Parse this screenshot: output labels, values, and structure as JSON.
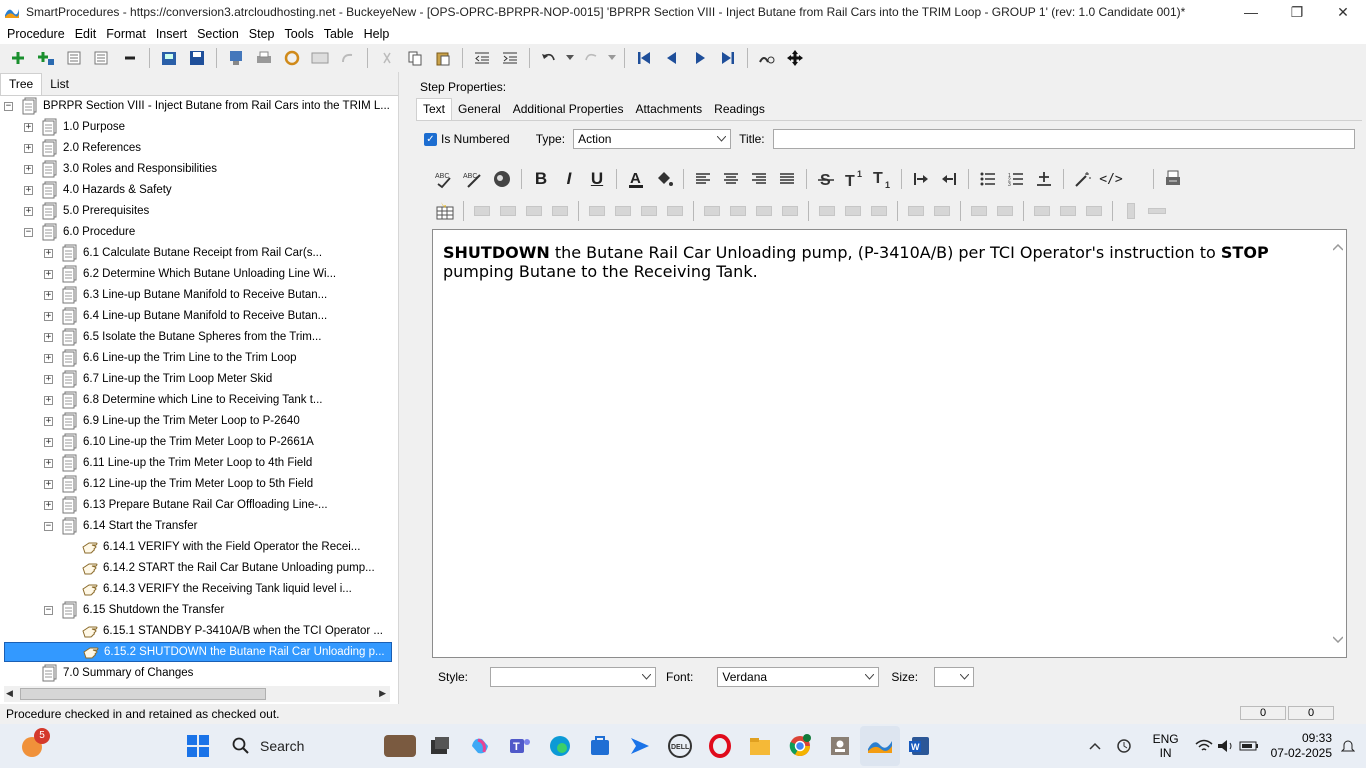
{
  "window": {
    "title": "SmartProcedures - https://conversion3.atrcloudhosting.net - BuckeyeNew - [OPS-OPRC-BPRPR-NOP-0015] 'BPRPR Section VIII - Inject Butane from Rail Cars into the TRIM Loop - GROUP 1' (rev: 1.0 Candidate 001)*"
  },
  "menu": [
    "Procedure",
    "Edit",
    "Format",
    "Insert",
    "Section",
    "Step",
    "Tools",
    "Table",
    "Help"
  ],
  "left_tabs": {
    "tree": "Tree",
    "list": "List"
  },
  "tree": {
    "root": "BPRPR Section VIII - Inject Butane from Rail Cars into the TRIM L...",
    "nodes": [
      {
        "label": "1.0 Purpose",
        "indent": 1,
        "expander": "+",
        "icon": "doc"
      },
      {
        "label": "2.0 References",
        "indent": 1,
        "expander": "+",
        "icon": "doc"
      },
      {
        "label": "3.0 Roles and Responsibilities",
        "indent": 1,
        "expander": "+",
        "icon": "doc"
      },
      {
        "label": "4.0 Hazards & Safety",
        "indent": 1,
        "expander": "+",
        "icon": "doc"
      },
      {
        "label": "5.0 Prerequisites",
        "indent": 1,
        "expander": "+",
        "icon": "doc"
      },
      {
        "label": "6.0 Procedure",
        "indent": 1,
        "expander": "-",
        "icon": "doc"
      },
      {
        "label": "6.1 Calculate Butane Receipt from Rail Car(s...",
        "indent": 2,
        "expander": "+",
        "icon": "doc"
      },
      {
        "label": "6.2 Determine Which Butane Unloading Line Wi...",
        "indent": 2,
        "expander": "+",
        "icon": "doc"
      },
      {
        "label": "6.3 Line-up Butane Manifold to Receive Butan...",
        "indent": 2,
        "expander": "+",
        "icon": "doc"
      },
      {
        "label": "6.4 Line-up Butane Manifold to Receive Butan...",
        "indent": 2,
        "expander": "+",
        "icon": "doc"
      },
      {
        "label": "6.5 Isolate the Butane Spheres from the Trim...",
        "indent": 2,
        "expander": "+",
        "icon": "doc"
      },
      {
        "label": "6.6 Line-up the Trim Line to the Trim Loop",
        "indent": 2,
        "expander": "+",
        "icon": "doc"
      },
      {
        "label": "6.7 Line-up the Trim Loop Meter Skid",
        "indent": 2,
        "expander": "+",
        "icon": "doc"
      },
      {
        "label": "6.8 Determine which Line to Receiving Tank t...",
        "indent": 2,
        "expander": "+",
        "icon": "doc"
      },
      {
        "label": "6.9 Line-up the Trim Meter Loop to P-2640",
        "indent": 2,
        "expander": "+",
        "icon": "doc"
      },
      {
        "label": "6.10 Line-up the Trim Meter Loop to P-2661A",
        "indent": 2,
        "expander": "+",
        "icon": "doc"
      },
      {
        "label": "6.11 Line-up the Trim Meter Loop to 4th Field",
        "indent": 2,
        "expander": "+",
        "icon": "doc"
      },
      {
        "label": "6.12 Line-up the Trim Meter Loop to 5th Field",
        "indent": 2,
        "expander": "+",
        "icon": "doc"
      },
      {
        "label": "6.13 Prepare Butane Rail Car Offloading Line-...",
        "indent": 2,
        "expander": "+",
        "icon": "doc"
      },
      {
        "label": "6.14 Start the Transfer",
        "indent": 2,
        "expander": "-",
        "icon": "doc"
      },
      {
        "label": "6.14.1 VERIFY with the Field Operator the Recei...",
        "indent": 3,
        "expander": "",
        "icon": "hand"
      },
      {
        "label": "6.14.2 START the Rail Car Butane Unloading pump...",
        "indent": 3,
        "expander": "",
        "icon": "hand"
      },
      {
        "label": "6.14.3 VERIFY the Receiving Tank liquid level i...",
        "indent": 3,
        "expander": "",
        "icon": "hand"
      },
      {
        "label": "6.15 Shutdown the Transfer",
        "indent": 2,
        "expander": "-",
        "icon": "doc"
      },
      {
        "label": "6.15.1 STANDBY P-3410A/B when the TCI Operator ...",
        "indent": 3,
        "expander": "",
        "icon": "hand"
      },
      {
        "label": "6.15.2 SHUTDOWN the Butane Rail Car Unloading p...",
        "indent": 3,
        "expander": "",
        "icon": "hand",
        "selected": true
      },
      {
        "label": "7.0 Summary of Changes",
        "indent": 1,
        "expander": "",
        "icon": "doc"
      }
    ]
  },
  "step_properties": {
    "label": "Step Properties:",
    "tabs": [
      "Text",
      "General",
      "Additional Properties",
      "Attachments",
      "Readings"
    ],
    "is_numbered_label": "Is Numbered",
    "type_label": "Type:",
    "type_value": "Action",
    "title_label": "Title:",
    "title_value": ""
  },
  "editor": {
    "segments": [
      {
        "text": "SHUTDOWN",
        "bold": true
      },
      {
        "text": " the Butane Rail Car Unloading pump, (P-3410A/B) per TCI Operator's instruction to ",
        "bold": false
      },
      {
        "text": "STOP",
        "bold": true
      },
      {
        "text": " pumping Butane to the Receiving Tank.",
        "bold": false
      }
    ]
  },
  "format_bar": {
    "style_label": "Style:",
    "style_value": "",
    "font_label": "Font:",
    "font_value": "Verdana",
    "size_label": "Size:",
    "size_value": ""
  },
  "status": {
    "text": "Procedure checked in and retained as checked out.",
    "right1": "0",
    "right2": "0"
  },
  "taskbar": {
    "search_label": "Search",
    "notification_badge": "5",
    "lang_line1": "ENG",
    "lang_line2": "IN",
    "time": "09:33",
    "date": "07-02-2025"
  }
}
